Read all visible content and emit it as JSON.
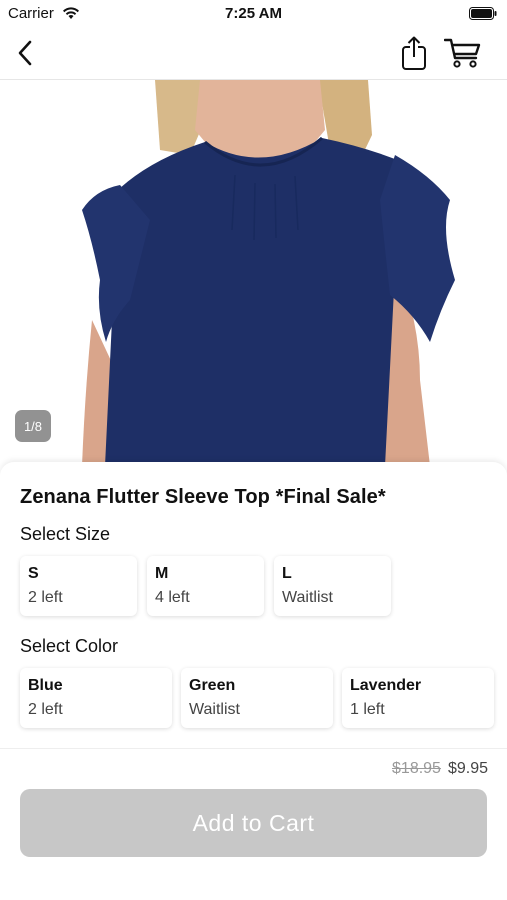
{
  "status_bar": {
    "carrier": "Carrier",
    "time": "7:25 AM"
  },
  "nav": {
    "back_icon": "chevron-left-icon",
    "share_icon": "share-icon",
    "cart_icon": "cart-icon"
  },
  "gallery": {
    "counter": "1/8",
    "garment_color": "#1e2f66"
  },
  "product": {
    "title": "Zenana Flutter Sleeve Top *Final Sale*"
  },
  "size_section": {
    "label": "Select Size",
    "options": [
      {
        "name": "S",
        "stock": "2 left"
      },
      {
        "name": "M",
        "stock": "4 left"
      },
      {
        "name": "L",
        "stock": "Waitlist"
      }
    ]
  },
  "color_section": {
    "label": "Select Color",
    "options": [
      {
        "name": "Blue",
        "stock": "2 left"
      },
      {
        "name": "Green",
        "stock": "Waitlist"
      },
      {
        "name": "Lavender",
        "stock": "1 left"
      }
    ]
  },
  "pricing": {
    "original": "$18.95",
    "sale": "$9.95"
  },
  "cart_button": {
    "label": "Add to Cart",
    "color": "#c7c7c7"
  }
}
